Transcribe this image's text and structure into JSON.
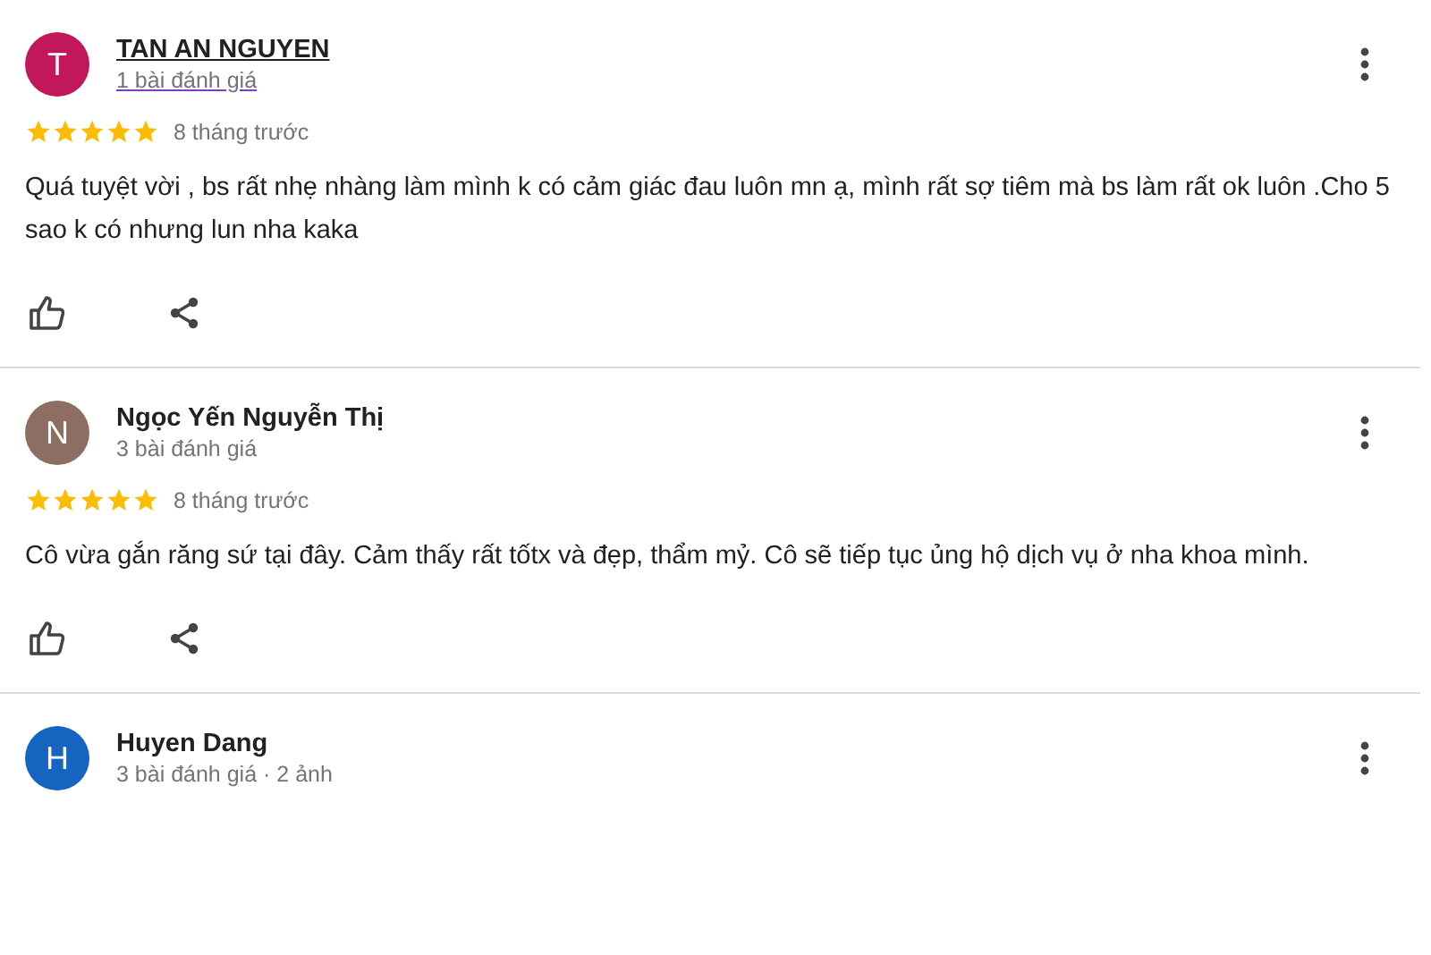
{
  "reviews": [
    {
      "initial": "T",
      "color": "#c2185b",
      "name": "TAN AN NGUYEN",
      "name_underlined": true,
      "meta": "1 bài đánh giá",
      "meta_underlined": true,
      "stars": 5,
      "time": "8 tháng trước",
      "text": "Quá tuyệt vời , bs rất nhẹ nhàng làm mình k có cảm giác đau luôn mn ạ, mình rất sợ tiêm mà bs làm rất ok luôn .Cho 5 sao k có nhưng lun nha kaka"
    },
    {
      "initial": "N",
      "color": "#8d6e63",
      "name": "Ngọc Yến Nguyễn Thị",
      "name_underlined": false,
      "meta": "3 bài đánh giá",
      "meta_underlined": false,
      "stars": 5,
      "time": "8 tháng trước",
      "text": "Cô vừa gắn răng sứ tại đây. Cảm thấy rất tốtx và đẹp, thẩm mỷ. Cô sẽ tiếp tục ủng hộ dịch vụ ở nha khoa mình."
    },
    {
      "initial": "H",
      "color": "#1565c0",
      "name": "Huyen Dang",
      "name_underlined": false,
      "meta": "3 bài đánh giá · 2 ảnh",
      "meta_underlined": false
    }
  ]
}
